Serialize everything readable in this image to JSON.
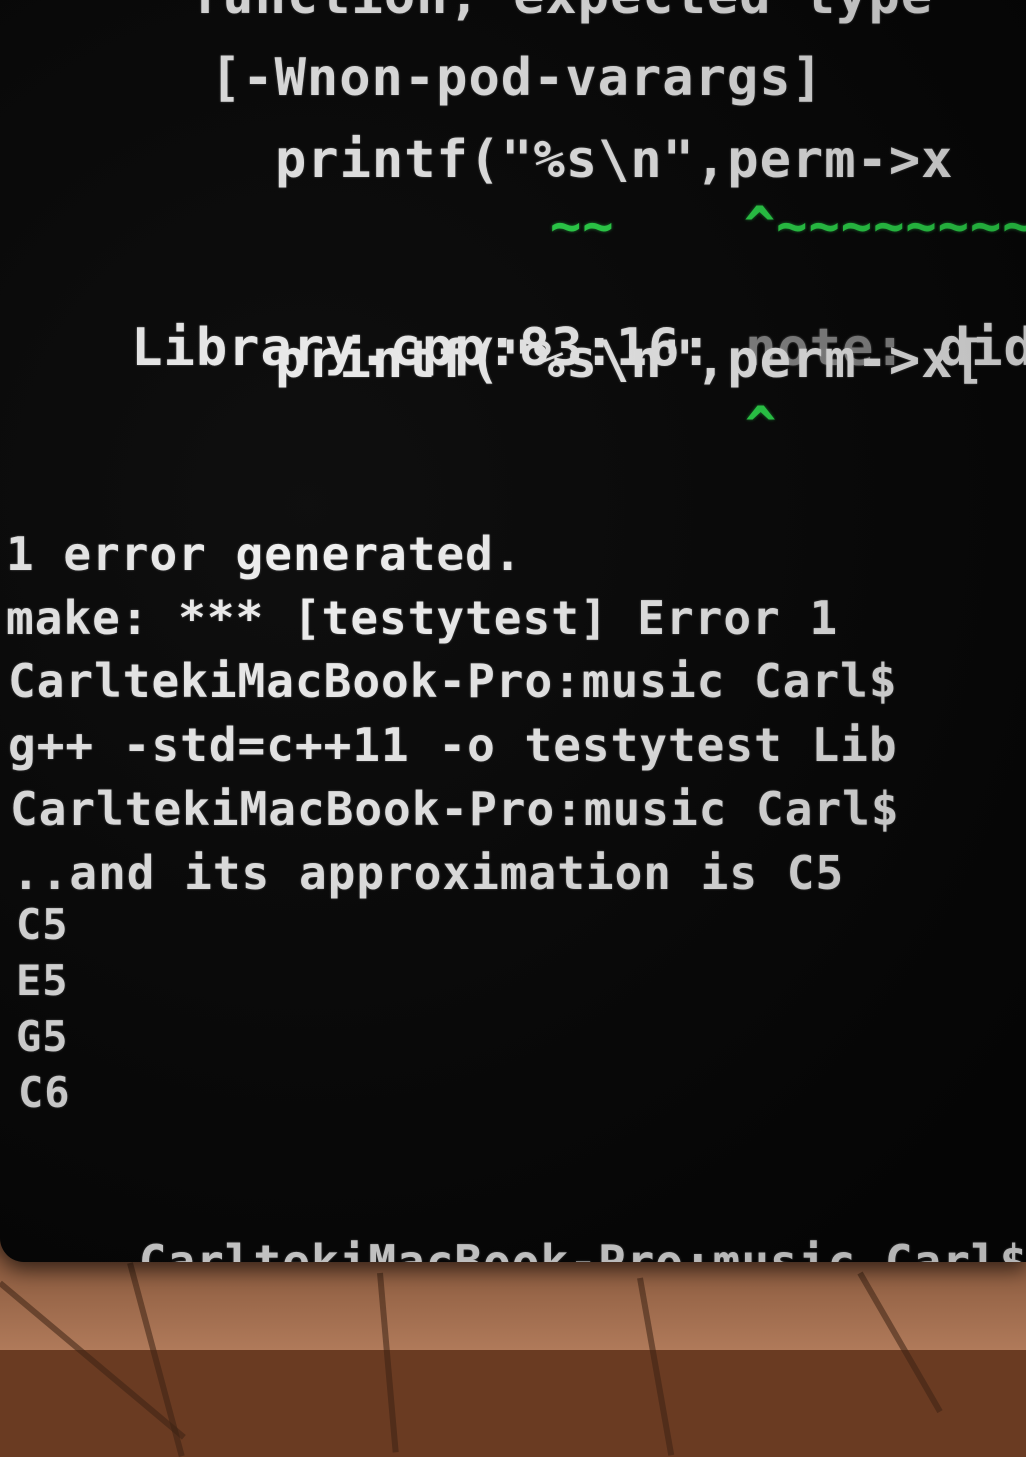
{
  "terminal": {
    "lines": {
      "l0": "function, expected type",
      "l1": "[-Wnon-pod-varargs]",
      "l2": "printf(\"%s\\n\",perm->x",
      "l3": "~~    ^~~~~~~~~",
      "l4_file": "Library.cpp:83:16: ",
      "l4_note": "note: ",
      "l4_rest": "did y",
      "l5": "printf(\"%s\\n\",perm->x[",
      "l6": "^",
      "l7": "1 error generated.",
      "l8": "make: *** [testytest] Error 1",
      "l9": "CarltekiMacBook-Pro:music Carl$",
      "l10": "g++ -std=c++11 -o testytest Lib",
      "l11": "CarltekiMacBook-Pro:music Carl$",
      "l12": "..and its approximation is C5",
      "l13": "C5",
      "l14": "E5",
      "l15": "G5",
      "l16": "C6",
      "l17": "CarltekiMacBook-Pro:music Carl$"
    }
  },
  "colors": {
    "text": "#f2f2f2",
    "note": "#8a8a8a",
    "caret_green": "#2bd94a",
    "background": "#070707"
  }
}
